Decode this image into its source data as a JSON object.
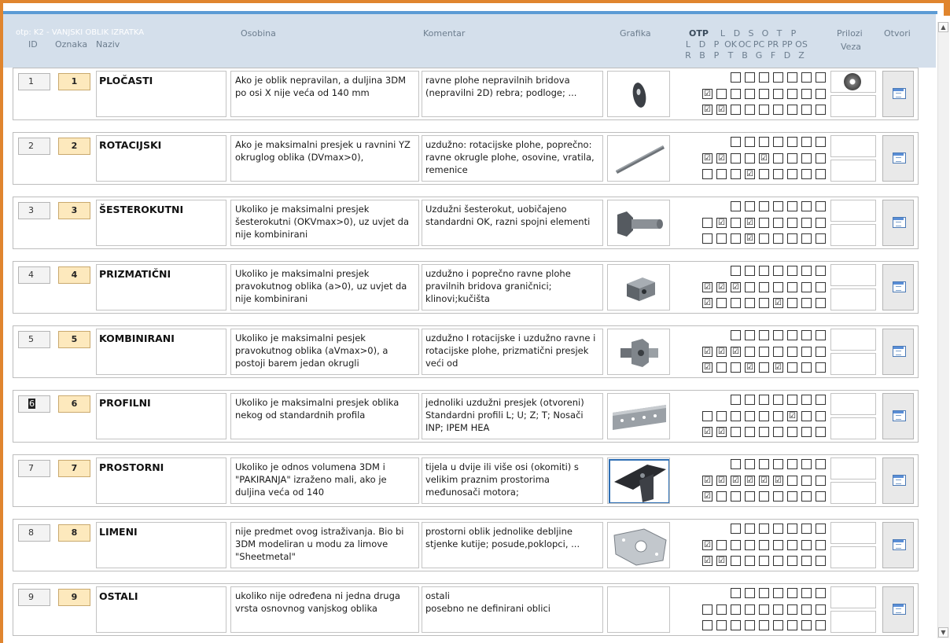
{
  "form": {
    "title": "otp: K2 - VANJSKI OBLIK IZRATKA",
    "headers": {
      "id": "ID",
      "oznaka": "Oznaka",
      "naziv": "Naziv",
      "osobina": "Osobina",
      "komentar": "Komentar",
      "grafika": "Grafika",
      "otp": "OTP",
      "otp_row1": [
        "L",
        "D",
        "S",
        "O",
        "T",
        "P"
      ],
      "otp_row2": [
        "L",
        "D",
        "P",
        "OK",
        "OC",
        "PC",
        "PR",
        "PP",
        "OS"
      ],
      "otp_row3": [
        "R",
        "B",
        "P",
        "T",
        "B",
        "G",
        "F",
        "D",
        "Z"
      ],
      "prilozi": "Prilozi",
      "veza": "Veza",
      "otvori": "Otvori"
    }
  },
  "rows": [
    {
      "id": "1",
      "oznaka": "1",
      "naziv": "PLOČASTI",
      "osobina": "Ako je oblik nepravilan, a duljina 3DM po osi X nije veća od 140 mm",
      "komentar": "ravne plohe nepravilnih bridova (nepravilni 2D) rebra; podloge; ...",
      "icon": "plate-part-icon",
      "line1": [
        false,
        false,
        false,
        false,
        false,
        false,
        false
      ],
      "line2": [
        true,
        false,
        false,
        false,
        false,
        false,
        false,
        false,
        false
      ],
      "line3": [
        true,
        true,
        false,
        false,
        false,
        false,
        false,
        false,
        false
      ],
      "prilog_icon": "disc-part-icon"
    },
    {
      "id": "2",
      "oznaka": "2",
      "naziv": "ROTACIJSKI",
      "osobina": "Ako je maksimalni presjek u ravnini YZ okruglog oblika (DVmax>0),",
      "komentar": "uzdužno: rotacijske plohe, poprečno: ravne okrugle plohe, osovine, vratila, remenice",
      "icon": "shaft-part-icon",
      "line1": [
        false,
        false,
        false,
        false,
        false,
        false,
        false
      ],
      "line2": [
        true,
        true,
        false,
        false,
        true,
        false,
        false,
        false,
        false
      ],
      "line3": [
        false,
        false,
        false,
        true,
        false,
        false,
        false,
        false,
        false
      ]
    },
    {
      "id": "3",
      "oznaka": "3",
      "naziv": "ŠESTEROKUTNI",
      "osobina": "Ukoliko je maksimalni presjek šesterokutni (OKVmax>0), uz uvjet da nije kombinirani",
      "komentar": "Uzdužni šesterokut, uobičajeno standardni OK, razni spojni elementi",
      "icon": "hex-bolt-icon",
      "line1": [
        false,
        false,
        false,
        false,
        false,
        false,
        false
      ],
      "line2": [
        false,
        true,
        false,
        true,
        false,
        false,
        false,
        false,
        false
      ],
      "line3": [
        false,
        false,
        false,
        true,
        false,
        false,
        false,
        false,
        false
      ]
    },
    {
      "id": "4",
      "oznaka": "4",
      "naziv": "PRIZMATIČNI",
      "osobina": "Ukoliko je maksimalni presjek pravokutnog oblika (a>0), uz uvjet da nije kombinirani",
      "komentar": " uzdužno i poprečno ravne plohe  pravilnih bridova graničnici; klinovi;kučišta",
      "icon": "cube-part-icon",
      "line1": [
        false,
        false,
        false,
        false,
        false,
        false,
        false
      ],
      "line2": [
        true,
        true,
        true,
        false,
        false,
        false,
        false,
        false,
        false
      ],
      "line3": [
        true,
        false,
        false,
        false,
        false,
        true,
        false,
        false,
        false
      ]
    },
    {
      "id": "5",
      "oznaka": "5",
      "naziv": "KOMBINIRANI",
      "osobina": "Ukoliko je maksimalni pesjek pravokutnog oblika (aVmax>0), a postoji barem jedan okrugli",
      "komentar": "uzdužno I rotacijske i uzdužno ravne  i rotacijske plohe, prizmatični presjek veći od",
      "icon": "combined-part-icon",
      "line1": [
        false,
        false,
        false,
        false,
        false,
        false,
        false
      ],
      "line2": [
        true,
        true,
        true,
        false,
        false,
        false,
        false,
        false,
        false
      ],
      "line3": [
        true,
        false,
        false,
        true,
        false,
        true,
        false,
        false,
        false
      ]
    },
    {
      "id": "6",
      "oznaka": "6",
      "naziv": "PROFILNI",
      "osobina": "Ukoliko je maksimalni presjek oblika nekog od standardnih profila",
      "komentar": "jednoliki uzdužni presjek (otvoreni) Standardni profili L; U; Z; T; Nosači INP; IPEM HEA",
      "icon": "profile-part-icon",
      "line1": [
        false,
        false,
        false,
        false,
        false,
        false,
        false
      ],
      "line2": [
        false,
        false,
        false,
        false,
        false,
        false,
        true,
        false,
        false
      ],
      "line3": [
        true,
        true,
        false,
        false,
        false,
        false,
        false,
        false,
        false
      ]
    },
    {
      "id": "7",
      "oznaka": "7",
      "naziv": "PROSTORNI",
      "osobina": "Ukoliko je odnos volumena 3DM i \"PAKIRANJA\" izraženo mali, ako je duljina veća od 140",
      "komentar": "tijela u dvije ili više osi (okomiti) s velikim praznim prostorima međunosači motora;",
      "icon": "spatial-part-icon",
      "line1": [
        false,
        false,
        false,
        false,
        false,
        false,
        false
      ],
      "line2": [
        true,
        true,
        true,
        true,
        true,
        true,
        false,
        false,
        false
      ],
      "line3": [
        true,
        false,
        false,
        false,
        false,
        false,
        false,
        false,
        false
      ]
    },
    {
      "id": "8",
      "oznaka": "8",
      "naziv": "LIMENI",
      "osobina": "nije predmet ovog istraživanja. Bio bi 3DM modeliran u modu za limove \"Sheetmetal\"",
      "komentar": " prostorni oblik jednolike debljine stjenke  kutije;  posude,poklopci, ...",
      "icon": "sheetmetal-part-icon",
      "line1": [
        false,
        false,
        false,
        false,
        false,
        false,
        false
      ],
      "line2": [
        true,
        false,
        false,
        false,
        false,
        false,
        false,
        false,
        false
      ],
      "line3": [
        true,
        true,
        false,
        false,
        false,
        false,
        false,
        false,
        false
      ]
    },
    {
      "id": "9",
      "oznaka": "9",
      "naziv": "OSTALI",
      "osobina": "ukoliko nije određena ni jedna druga vrsta osnovnog vanjskog oblika",
      "komentar": "ostali\nposebno ne definirani oblici",
      "icon": "",
      "line1": [
        false,
        false,
        false,
        false,
        false,
        false,
        false
      ],
      "line2": [
        false,
        false,
        false,
        false,
        false,
        false,
        false,
        false,
        false
      ],
      "line3": [
        false,
        false,
        false,
        false,
        false,
        false,
        false,
        false,
        false
      ]
    }
  ],
  "check_glyph": "☑"
}
